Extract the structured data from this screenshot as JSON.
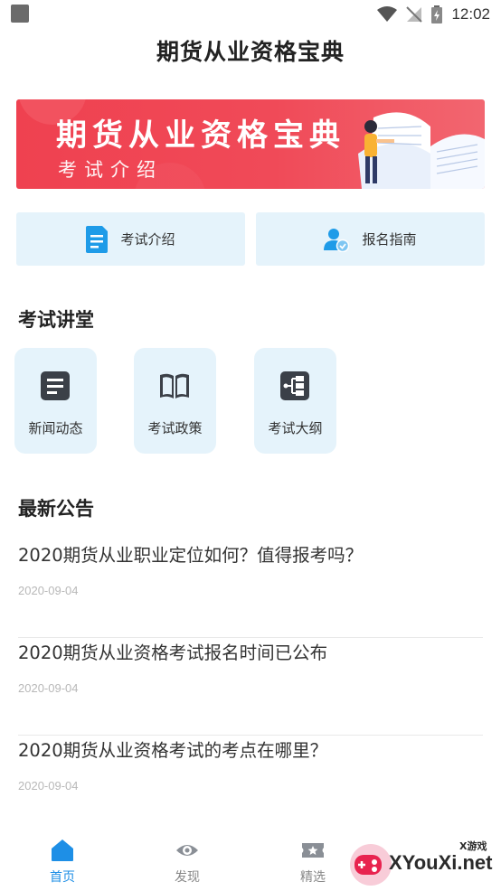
{
  "status_bar": {
    "time": "12:02"
  },
  "app_title": "期货从业资格宝典",
  "banner": {
    "title": "期货从业资格宝典",
    "subtitle": "考试介绍"
  },
  "quick_buttons": [
    {
      "label": "考试介绍",
      "icon": "document-icon"
    },
    {
      "label": "报名指南",
      "icon": "user-check-icon"
    }
  ],
  "lecture_section": {
    "title": "考试讲堂",
    "tiles": [
      {
        "label": "新闻动态",
        "icon": "news-icon"
      },
      {
        "label": "考试政策",
        "icon": "book-icon"
      },
      {
        "label": "考试大纲",
        "icon": "outline-icon"
      }
    ]
  },
  "news_section": {
    "title": "最新公告",
    "items": [
      {
        "title": "2020期货从业职业定位如何？值得报考吗？",
        "date": "2020-09-04"
      },
      {
        "title": "2020期货从业资格考试报名时间已公布",
        "date": "2020-09-04"
      },
      {
        "title": "2020期货从业资格考试的考点在哪里？",
        "date": "2020-09-04"
      }
    ]
  },
  "bottom_nav": [
    {
      "label": "首页",
      "icon": "home-icon",
      "active": true
    },
    {
      "label": "发现",
      "icon": "eye-icon",
      "active": false
    },
    {
      "label": "精选",
      "icon": "ticket-star-icon",
      "active": false
    }
  ],
  "watermark": {
    "text": "XYouXi.net",
    "small": "X游戏"
  },
  "colors": {
    "accent": "#1e8fe6",
    "tile_bg": "#e5f3fb",
    "banner_red": "#ef4150"
  }
}
